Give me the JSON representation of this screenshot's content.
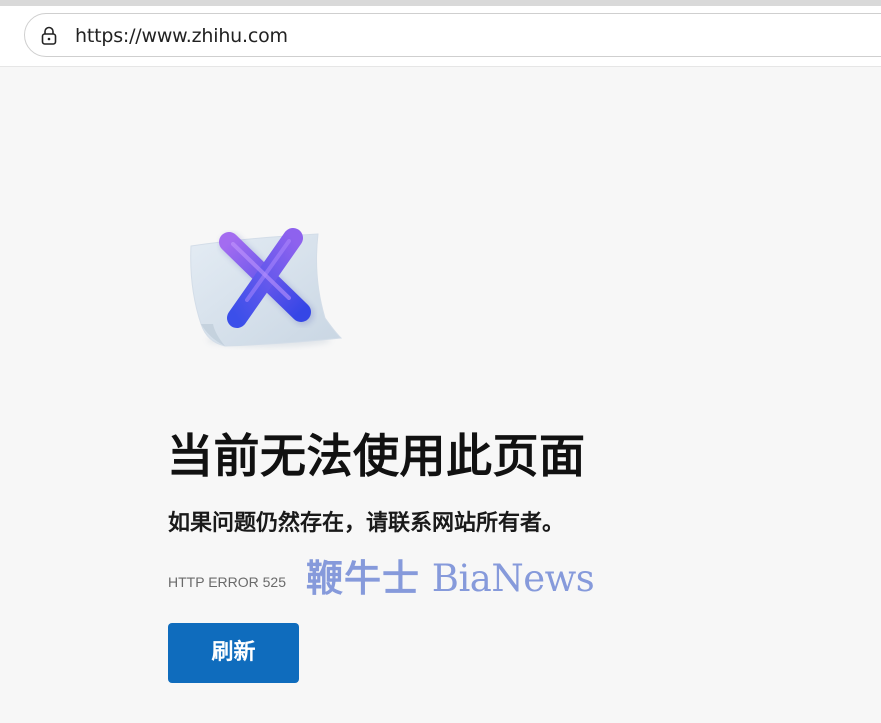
{
  "browser": {
    "url": "https://www.zhihu.com",
    "lock_icon": "lock-icon"
  },
  "error_page": {
    "illustration_icon": "error-x-document-icon",
    "headline": "当前无法使用此页面",
    "subtext": "如果问题仍然存在，请联系网站所有者。",
    "error_code": "HTTP ERROR 525",
    "refresh_label": "刷新"
  },
  "watermark": {
    "chinese": "鞭牛士",
    "english": "BiaNews"
  },
  "colors": {
    "page_background": "#f7f7f7",
    "button_blue": "#0f6cbd",
    "watermark": "#7d93d9",
    "x_mark_start": "#9b6cf2",
    "x_mark_end": "#3d4be8"
  }
}
